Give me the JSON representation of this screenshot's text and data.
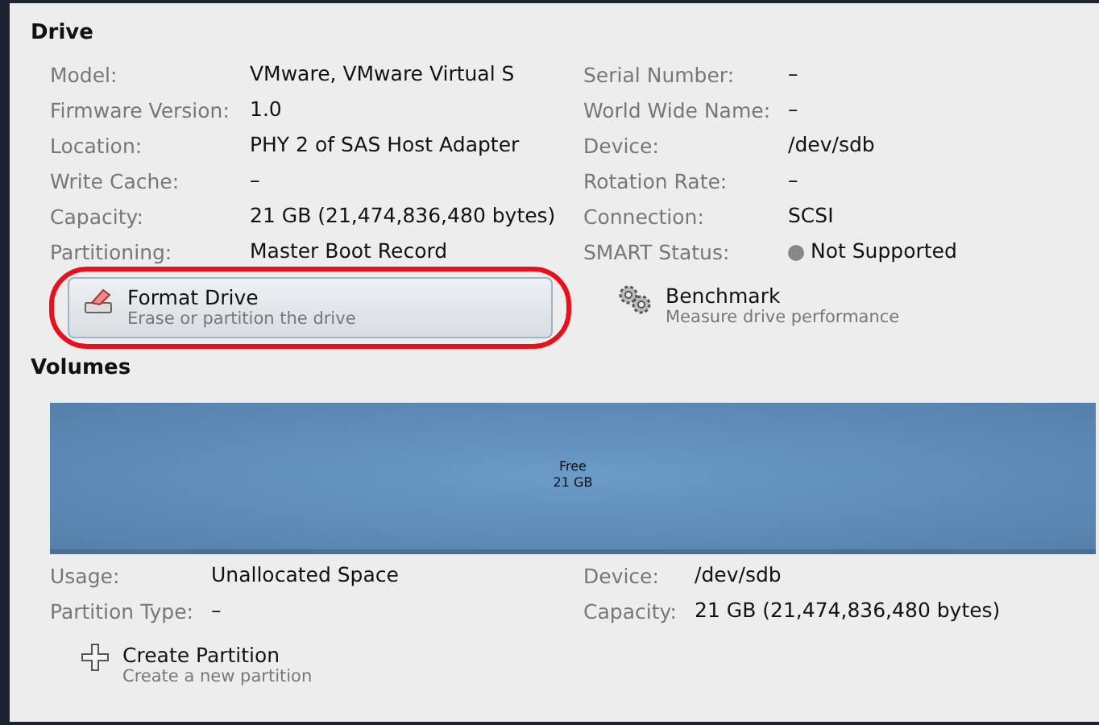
{
  "drive": {
    "title": "Drive",
    "left": [
      {
        "label": "Model:",
        "value": "VMware, VMware Virtual S"
      },
      {
        "label": "Firmware Version:",
        "value": "1.0"
      },
      {
        "label": "Location:",
        "value": "PHY 2 of SAS Host Adapter"
      },
      {
        "label": "Write Cache:",
        "value": "–"
      },
      {
        "label": "Capacity:",
        "value": "21 GB (21,474,836,480 bytes)"
      },
      {
        "label": "Partitioning:",
        "value": "Master Boot Record"
      }
    ],
    "right": [
      {
        "label": "Serial Number:",
        "value": "–"
      },
      {
        "label": "World Wide Name:",
        "value": "–"
      },
      {
        "label": "Device:",
        "value": "/dev/sdb"
      },
      {
        "label": "Rotation Rate:",
        "value": "–"
      },
      {
        "label": "Connection:",
        "value": "SCSI"
      },
      {
        "label": "SMART Status:",
        "value": "Not Supported",
        "kind": "status"
      }
    ],
    "actions": [
      {
        "kind": "format",
        "title": "Format Drive",
        "subtitle": "Erase or partition the drive",
        "highlighted": true
      },
      {
        "kind": "benchmark",
        "title": "Benchmark",
        "subtitle": "Measure drive performance",
        "highlighted": false
      }
    ]
  },
  "volumes": {
    "title": "Volumes",
    "segment": {
      "name": "Free",
      "size": "21 GB"
    },
    "left": [
      {
        "label": "Usage:",
        "value": "Unallocated Space"
      },
      {
        "label": "Partition Type:",
        "value": "–"
      }
    ],
    "right": [
      {
        "label": "Device:",
        "value": "/dev/sdb"
      },
      {
        "label": "Capacity:",
        "value": "21 GB (21,474,836,480 bytes)"
      }
    ],
    "actions": [
      {
        "kind": "create",
        "title": "Create Partition",
        "subtitle": "Create a new partition",
        "highlighted": false
      }
    ]
  }
}
